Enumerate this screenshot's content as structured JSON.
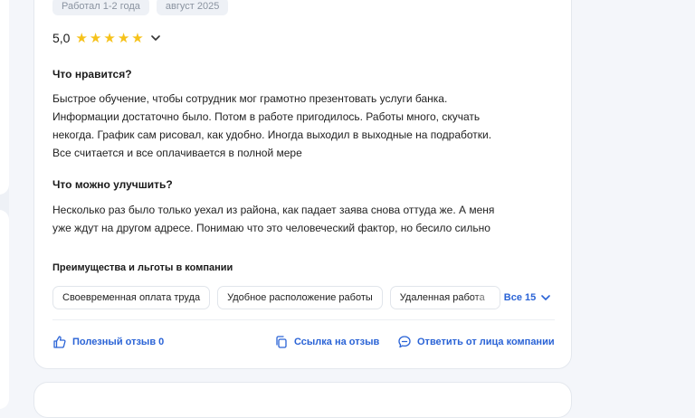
{
  "tags": [
    "Работал 1-2 года",
    "август 2025"
  ],
  "rating": {
    "value": "5,0",
    "stars": 5,
    "star_color": "#f6c21a"
  },
  "pros": {
    "title": "Что нравится?",
    "lines": [
      "Быстрое обучение, чтобы сотрудник мог грамотно презентовать услуги банка.",
      "Информации достаточно было. Потом в работе пригодилось. Работы много, скучать",
      "некогда. График сам рисовал, как удобно. Иногда выходил в выходные на подработки.",
      "Все считается и все оплачивается в полной мере"
    ]
  },
  "cons": {
    "title": "Что можно улучшить?",
    "lines": [
      "Несколько раз было только уехал из района, как падает заява снова оттуда же. А меня",
      "уже ждут на другом адресе. Понимаю что это человеческий фактор, но бесило сильно"
    ]
  },
  "benefits": {
    "title": "Преимущества и льготы в компании",
    "chips": [
      "Своевременная оплата труда",
      "Удобное расположение работы",
      "Удаленная работа"
    ],
    "all_label": "Все 15"
  },
  "actions": {
    "useful": "Полезный отзыв 0",
    "link": "Ссылка на отзыв",
    "reply": "Ответить от лица компании"
  },
  "colors": {
    "accent": "#2a63d6",
    "star": "#f6c21a"
  },
  "icons": [
    "chevron-down-icon",
    "thumbs-up-icon",
    "copy-link-icon",
    "chat-bubble-icon"
  ]
}
